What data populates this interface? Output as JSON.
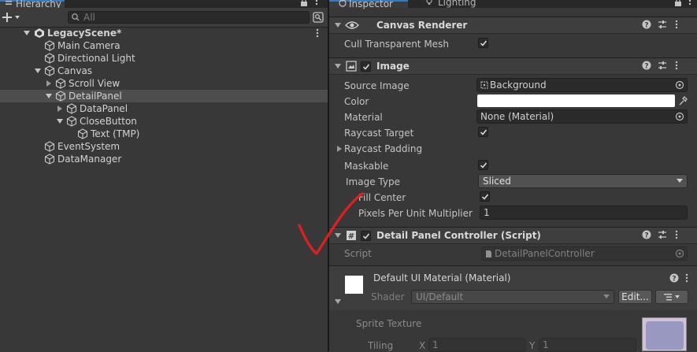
{
  "hierarchy": {
    "tab_label": "Hierarchy",
    "search_placeholder": "All",
    "scene_name": "LegacyScene*",
    "items": [
      {
        "label": "Main Camera"
      },
      {
        "label": "Directional Light"
      },
      {
        "label": "Canvas"
      },
      {
        "label": "Scroll View"
      },
      {
        "label": "DetailPanel"
      },
      {
        "label": "DataPanel"
      },
      {
        "label": "CloseButton"
      },
      {
        "label": "Text (TMP)"
      },
      {
        "label": "EventSystem"
      },
      {
        "label": "DataManager"
      }
    ]
  },
  "inspector": {
    "tabs": [
      "Inspector",
      "Lighting"
    ],
    "canvas_renderer": {
      "title": "Canvas Renderer",
      "cull_label": "Cull Transparent Mesh",
      "cull_checked": true
    },
    "image": {
      "title": "Image",
      "source_image_label": "Source Image",
      "source_image_value": "Background",
      "color_label": "Color",
      "color_value": "#ffffff",
      "material_label": "Material",
      "material_value": "None (Material)",
      "raycast_target_label": "Raycast Target",
      "raycast_padding_label": "Raycast Padding",
      "maskable_label": "Maskable",
      "image_type_label": "Image Type",
      "image_type_value": "Sliced",
      "fill_center_label": "Fill Center",
      "ppu_label": "Pixels Per Unit Multiplier",
      "ppu_value": "1"
    },
    "controller": {
      "title": "Detail Panel Controller (Script)",
      "script_label": "Script",
      "script_value": "DetailPanelController"
    },
    "material": {
      "title": "Default UI Material (Material)",
      "shader_label": "Shader",
      "shader_value": "UI/Default",
      "edit_label": "Edit...",
      "sprite_texture_label": "Sprite Texture",
      "tiling_label": "Tiling",
      "x_label": "X",
      "x_value": "1",
      "y_label": "Y",
      "y_value": "1"
    }
  },
  "annotation_color": "#e02020"
}
